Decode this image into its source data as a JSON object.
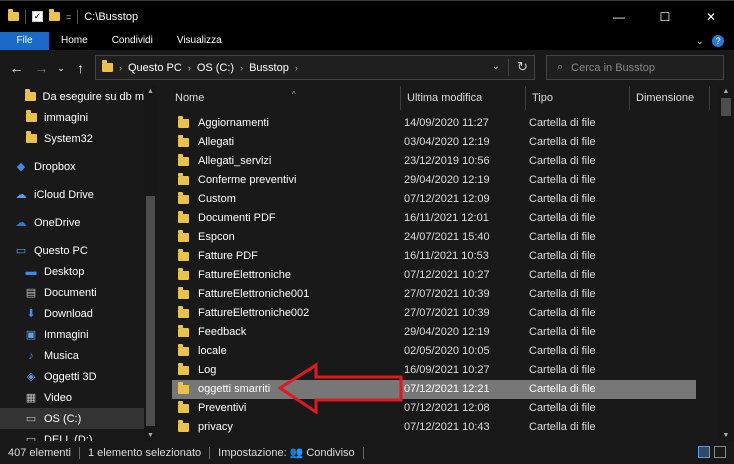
{
  "window": {
    "title": "C:\\Busstop",
    "minimize_glyph": "—",
    "maximize_glyph": "☐",
    "close_glyph": "✕",
    "quick_access_pin": "=",
    "check_glyph": "✓"
  },
  "ribbon": {
    "tabs": [
      "File",
      "Home",
      "Condividi",
      "Visualizza"
    ],
    "collapse_glyph": "⌄",
    "help_glyph": "?"
  },
  "nav": {
    "back_glyph": "←",
    "forward_glyph": "→",
    "recent_glyph": "⌄",
    "up_glyph": "↑",
    "breadcrumbs": [
      "Questo PC",
      "OS (C:)",
      "Busstop"
    ],
    "crumb_separator": "›",
    "dropdown_glyph": "⌄",
    "refresh_glyph": "↻",
    "search_placeholder": "Cerca in Busstop",
    "search_glyph": "⌕"
  },
  "sidebar": {
    "items": [
      {
        "label": "Da eseguire su db m",
        "icon": "folder-icon"
      },
      {
        "label": "immagini",
        "icon": "folder-icon"
      },
      {
        "label": "System32",
        "icon": "folder-icon"
      },
      {
        "label": "Dropbox",
        "icon": "dropbox-icon"
      },
      {
        "label": "iCloud Drive",
        "icon": "icloud-icon"
      },
      {
        "label": "OneDrive",
        "icon": "onedrive-icon"
      },
      {
        "label": "Questo PC",
        "icon": "pc-icon"
      },
      {
        "label": "Desktop",
        "icon": "desktop-icon"
      },
      {
        "label": "Documenti",
        "icon": "documents-icon"
      },
      {
        "label": "Download",
        "icon": "download-icon"
      },
      {
        "label": "Immagini",
        "icon": "pictures-icon"
      },
      {
        "label": "Musica",
        "icon": "music-icon"
      },
      {
        "label": "Oggetti 3D",
        "icon": "3d-objects-icon"
      },
      {
        "label": "Video",
        "icon": "video-icon"
      },
      {
        "label": "OS (C:)",
        "icon": "drive-icon"
      },
      {
        "label": "DELL (D:)",
        "icon": "drive-icon"
      }
    ],
    "selected_index": 14
  },
  "columns": {
    "name": "Nome",
    "modified": "Ultima modifica",
    "type": "Tipo",
    "size": "Dimensione",
    "sort_glyph": "^"
  },
  "files": [
    {
      "name": "Aggiornamenti",
      "modified": "14/09/2020 11:27",
      "type": "Cartella di file"
    },
    {
      "name": "Allegati",
      "modified": "03/04/2020 12:19",
      "type": "Cartella di file"
    },
    {
      "name": "Allegati_servizi",
      "modified": "23/12/2019 10:56",
      "type": "Cartella di file"
    },
    {
      "name": "Conferme preventivi",
      "modified": "29/04/2020 12:19",
      "type": "Cartella di file"
    },
    {
      "name": "Custom",
      "modified": "07/12/2021 12:09",
      "type": "Cartella di file"
    },
    {
      "name": "Documenti PDF",
      "modified": "16/11/2021 12:01",
      "type": "Cartella di file"
    },
    {
      "name": "Espcon",
      "modified": "24/07/2021 15:40",
      "type": "Cartella di file"
    },
    {
      "name": "Fatture PDF",
      "modified": "16/11/2021 10:53",
      "type": "Cartella di file"
    },
    {
      "name": "FattureElettroniche",
      "modified": "07/12/2021 10:27",
      "type": "Cartella di file"
    },
    {
      "name": "FattureElettroniche001",
      "modified": "27/07/2021 10:39",
      "type": "Cartella di file"
    },
    {
      "name": "FattureElettroniche002",
      "modified": "27/07/2021 10:39",
      "type": "Cartella di file"
    },
    {
      "name": "Feedback",
      "modified": "29/04/2020 12:19",
      "type": "Cartella di file"
    },
    {
      "name": "locale",
      "modified": "02/05/2020 10:05",
      "type": "Cartella di file"
    },
    {
      "name": "Log",
      "modified": "16/09/2021 10:27",
      "type": "Cartella di file"
    },
    {
      "name": "oggetti smarriti",
      "modified": "07/12/2021 12:21",
      "type": "Cartella di file"
    },
    {
      "name": "Preventivi",
      "modified": "07/12/2021 12:08",
      "type": "Cartella di file"
    },
    {
      "name": "privacy",
      "modified": "07/12/2021 10:43",
      "type": "Cartella di file"
    }
  ],
  "selected_file_index": 14,
  "status": {
    "count": "407 elementi",
    "selection": "1 elemento selezionato",
    "sharing": "Impostazione:",
    "sharing_value": "Condiviso"
  },
  "colors": {
    "accent": "#1b6ac7",
    "folder": "#e8c24a",
    "selection": "#777777",
    "annotation_arrow": "#e0191e"
  }
}
